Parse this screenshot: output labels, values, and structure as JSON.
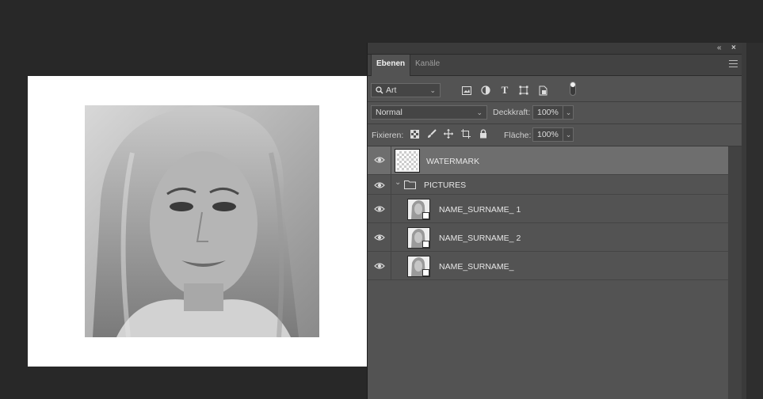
{
  "panel": {
    "collapse_icon": "double-chevron-left-icon",
    "close_icon": "close-icon",
    "tabs": [
      {
        "label": "Ebenen",
        "active": true
      },
      {
        "label": "Kanäle",
        "active": false
      }
    ],
    "menu_icon": "hamburger-menu-icon"
  },
  "filter": {
    "kind_label": "Art",
    "icons": [
      "image-filter-icon",
      "adjustment-filter-icon",
      "type-filter-icon",
      "shape-filter-icon",
      "smart-object-filter-icon",
      "filter-toggle-icon"
    ]
  },
  "blend": {
    "mode": "Normal",
    "opacity_label": "Deckkraft:",
    "opacity_value": "100%"
  },
  "lock": {
    "label": "Fixieren:",
    "icons": [
      "lock-transparent-pixels-icon",
      "lock-image-pixels-icon",
      "lock-position-icon",
      "lock-artboard-icon",
      "lock-all-icon"
    ],
    "fill_label": "Fläche:",
    "fill_value": "100%"
  },
  "layers": [
    {
      "name": "WATERMARK",
      "type": "layer",
      "selected": true,
      "visible": true
    },
    {
      "name": "PICTURES",
      "type": "group",
      "expanded": true,
      "visible": true
    },
    {
      "name": "NAME_SURNAME_ 1",
      "type": "smart-object",
      "visible": true
    },
    {
      "name": "NAME_SURNAME_ 2",
      "type": "smart-object",
      "visible": true
    },
    {
      "name": "NAME_SURNAME_",
      "type": "smart-object",
      "visible": true
    }
  ],
  "colors": {
    "workspace": "#282828",
    "panel": "#535353",
    "selected_layer": "#6e6e6e"
  }
}
